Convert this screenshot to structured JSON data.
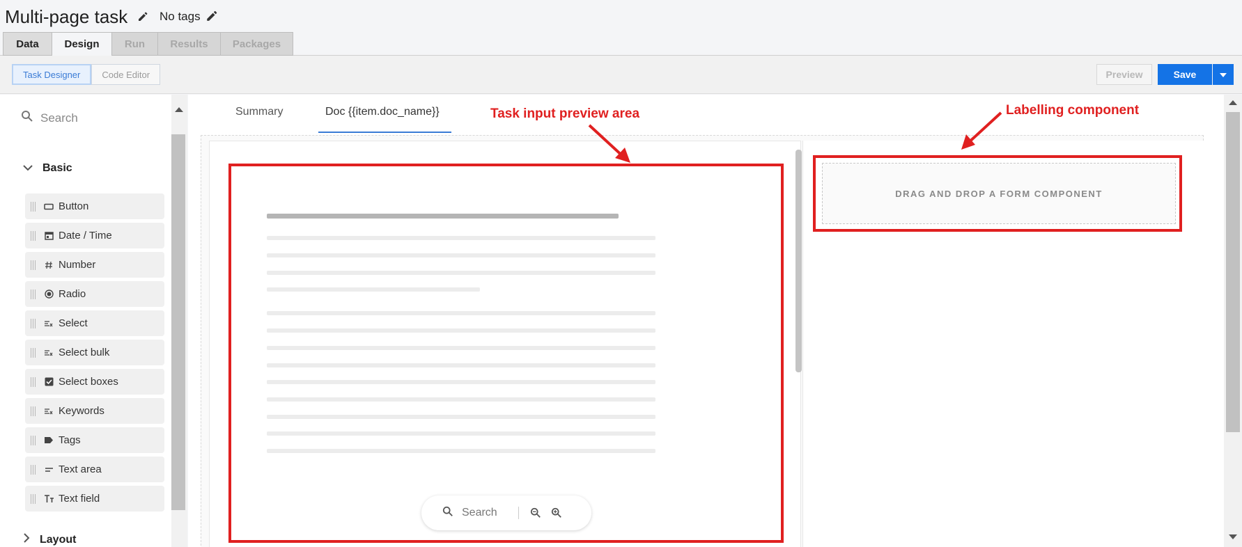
{
  "header": {
    "title": "Multi-page task",
    "tags_label": "No tags"
  },
  "tabs": [
    {
      "label": "Data"
    },
    {
      "label": "Design"
    },
    {
      "label": "Run"
    },
    {
      "label": "Results"
    },
    {
      "label": "Packages"
    }
  ],
  "toolbar": {
    "mode_task_designer": "Task Designer",
    "mode_code_editor": "Code Editor",
    "preview_label": "Preview",
    "save_label": "Save"
  },
  "palette": {
    "search_placeholder": "Search",
    "basic_label": "Basic",
    "layout_label": "Layout",
    "items": [
      {
        "label": "Button",
        "icon": "button-icon"
      },
      {
        "label": "Date / Time",
        "icon": "calendar-icon"
      },
      {
        "label": "Number",
        "icon": "hash-icon"
      },
      {
        "label": "Radio",
        "icon": "radio-icon"
      },
      {
        "label": "Select",
        "icon": "select-icon"
      },
      {
        "label": "Select bulk",
        "icon": "select-bulk-icon"
      },
      {
        "label": "Select boxes",
        "icon": "checkbox-icon"
      },
      {
        "label": "Keywords",
        "icon": "keywords-icon"
      },
      {
        "label": "Tags",
        "icon": "tag-icon"
      },
      {
        "label": "Text area",
        "icon": "text-area-icon"
      },
      {
        "label": "Text field",
        "icon": "text-field-icon"
      }
    ]
  },
  "preview": {
    "tab_summary": "Summary",
    "tab_doc": "Doc {{item.doc_name}}",
    "dropzone_text": "DRAG AND DROP A FORM COMPONENT",
    "zoom_search_placeholder": "Search"
  },
  "annotations": {
    "task_input": "Task input preview area",
    "labelling": "Labelling component"
  },
  "colors": {
    "accent": "#1473e6",
    "annotation": "#e02020"
  }
}
